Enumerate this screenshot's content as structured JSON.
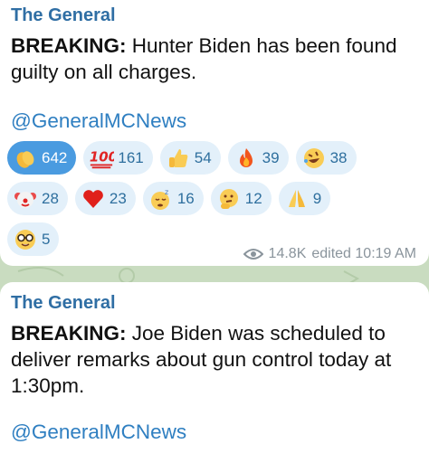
{
  "posts": [
    {
      "sender": "The General",
      "bold_prefix": "BREAKING:",
      "text": " Hunter Biden has been found guilty on all charges.",
      "link": "@GeneralMCNews",
      "reactions_row1": [
        {
          "icon": "clapping-hands-icon",
          "count": "642"
        },
        {
          "icon": "hundred-points-icon",
          "count": "161"
        },
        {
          "icon": "thumbs-up-icon",
          "count": "54"
        },
        {
          "icon": "fire-icon",
          "count": "39"
        },
        {
          "icon": "rolling-laughing-icon",
          "count": "38"
        }
      ],
      "reactions_row2": [
        {
          "icon": "clown-face-icon",
          "count": "28"
        },
        {
          "icon": "red-heart-icon",
          "count": "23"
        },
        {
          "icon": "sleeping-face-icon",
          "count": "16"
        },
        {
          "icon": "thinking-face-icon",
          "count": "12"
        },
        {
          "icon": "folded-hands-icon",
          "count": "9"
        }
      ],
      "reactions_row3": [
        {
          "icon": "nerd-face-icon",
          "count": "5"
        }
      ],
      "views": "14.8K",
      "edited": "edited 10:19 AM"
    },
    {
      "sender": "The General",
      "bold_prefix": "BREAKING:",
      "text": " Joe Biden was scheduled to deliver remarks about gun control today at 1:30pm.",
      "link": "@GeneralMCNews"
    }
  ],
  "colors": {
    "sender": "#2f6ea4",
    "link": "#2f7fc1",
    "chip_bg": "#e3f0fa",
    "chip_active_bg": "#4a9be0",
    "chat_bg": "#c9dcc0"
  }
}
